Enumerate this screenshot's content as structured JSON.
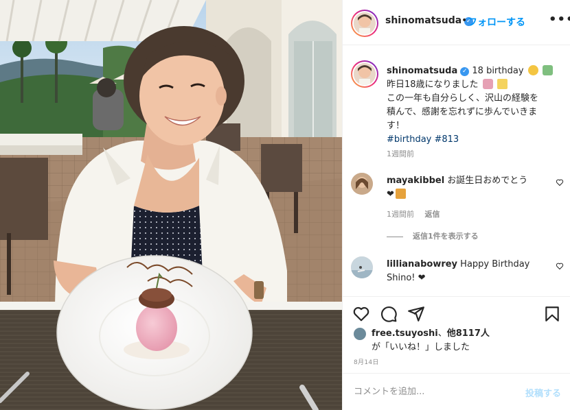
{
  "header": {
    "username": "shinomatsuda",
    "verified_icon": "verified-badge-icon",
    "separator": "•",
    "follow_label": "フォローする",
    "more_label": "•••"
  },
  "caption": {
    "username": "shinomatsuda",
    "line1": "18 birthday",
    "line2": "昨日18歳になりました",
    "line3": "この一年も自分らしく、沢山の経験を",
    "line4": "積んで、感謝を忘れずに歩んでいきま",
    "line5": "す！",
    "hashtag1": "#birthday",
    "hashtag2": "#813",
    "time": "1週間前"
  },
  "comments": [
    {
      "username": "mayakibbel",
      "text": "お誕生日おめでとう",
      "time": "1週間前",
      "reply_label": "返信"
    },
    {
      "username": "lillianabowrey",
      "text": "Happy Birthday",
      "text2": "Shino! ❤"
    }
  ],
  "view_replies": "返信1件を表示する",
  "likes": {
    "by_user": "free.tsuyoshi",
    "others": "他8117人",
    "suffix": "が「いいね！」しました"
  },
  "date": "8月14日",
  "comment_input": {
    "placeholder": "コメントを追加..."
  },
  "post_label": "投稿する",
  "colors": {
    "accent": "#0095f6",
    "hashtag": "#00376b",
    "muted": "#8e8e8e",
    "post_disabled": "#b2dffc"
  }
}
